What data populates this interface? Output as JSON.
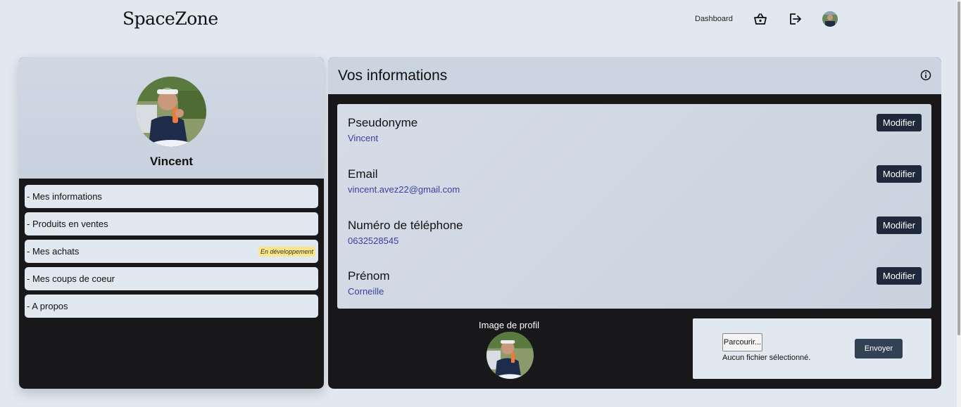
{
  "header": {
    "brand": "SpaceZone",
    "nav": {
      "dashboard": "Dashboard"
    }
  },
  "sidebar": {
    "user_name": "Vincent",
    "items": [
      {
        "label": "- Mes informations"
      },
      {
        "label": "- Produits en ventes"
      },
      {
        "label": "- Mes achats",
        "badge": "En développement"
      },
      {
        "label": "- Mes coups de coeur"
      },
      {
        "label": "- A propos"
      }
    ]
  },
  "main": {
    "title": "Vos informations",
    "fields": [
      {
        "label": "Pseudonyme",
        "value": "Vincent",
        "button": "Modifier"
      },
      {
        "label": "Email",
        "value": "vincent.avez22@gmail.com",
        "button": "Modifier"
      },
      {
        "label": "Numéro de téléphone",
        "value": "0632528545",
        "button": "Modifier"
      },
      {
        "label": "Prénom",
        "value": "Corneille",
        "button": "Modifier"
      }
    ],
    "profile_picture": {
      "label": "Image de profil",
      "browse_label": "Parcourir...",
      "file_status": "Aucun fichier sélectionné.",
      "send_label": "Envoyer"
    }
  },
  "colors": {
    "page_bg": "#e2e8f0",
    "panel_dark": "#18181b",
    "panel_light": "#cbd5e1",
    "button_dark": "#1e293b",
    "value_text": "#3b3fa0",
    "badge_bg": "#fde68a"
  },
  "icons": {
    "basket": "basket-icon",
    "logout": "logout-icon",
    "info": "info-icon"
  }
}
